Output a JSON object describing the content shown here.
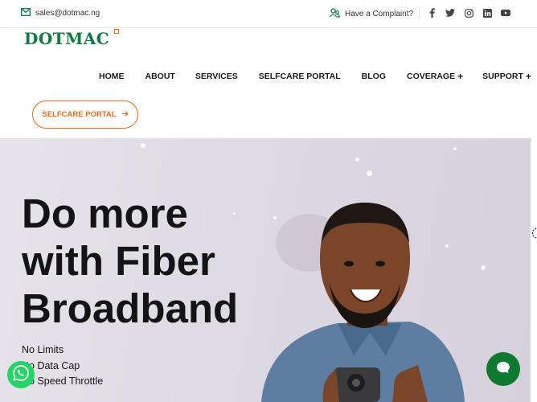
{
  "topbar": {
    "email": "sales@dotmac.ng",
    "complaint": "Have a Complaint?",
    "social": [
      "facebook-icon",
      "twitter-icon",
      "instagram-icon",
      "linkedin-icon",
      "youtube-icon"
    ]
  },
  "brand": {
    "logo": "DOTMAC",
    "green": "#0d7a3e",
    "orange": "#e36a1f"
  },
  "nav": {
    "items": [
      {
        "label": "HOME"
      },
      {
        "label": "ABOUT"
      },
      {
        "label": "SERVICES"
      },
      {
        "label": "SELFCARE PORTAL"
      },
      {
        "label": "BLOG"
      },
      {
        "label": "COVERAGE",
        "plus": "+"
      },
      {
        "label": "SUPPORT",
        "plus": "+"
      }
    ],
    "cta": "SELFCARE PORTAL"
  },
  "hero": {
    "title_lines": [
      "Do more",
      "with Fiber",
      "Broadband"
    ],
    "features": [
      "No Limits",
      "No Data Cap",
      "No Speed Throttle"
    ]
  }
}
